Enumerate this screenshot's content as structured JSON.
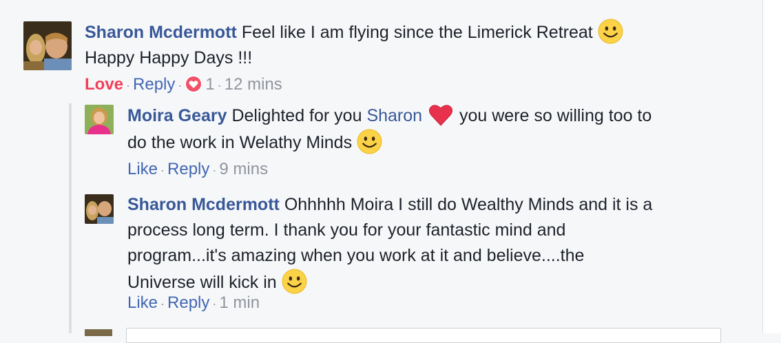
{
  "comments": [
    {
      "author": "Sharon Mcdermott",
      "text_line1": "Feel like I am flying since the Limerick Retreat",
      "text_line2": "Happy Happy Days !!!",
      "love_label": "Love",
      "reply_label": "Reply",
      "reaction_count": "1",
      "time": "12 mins"
    },
    {
      "author": "Moira Geary",
      "text_a": "Delighted for you",
      "mention": "Sharon",
      "text_b": "you were so willing too to",
      "text_line2": "do the work in Welathy Minds",
      "like_label": "Like",
      "reply_label": "Reply",
      "time": "9 mins"
    },
    {
      "author": "Sharon Mcdermott",
      "text_line1": "Ohhhhh Moira I still do Wealthy Minds and it is a",
      "text_line2": "process long term. I thank you for your fantastic mind and",
      "text_line3": "program...it's amazing when you work at it and believe....the",
      "text_line4": "Universe will kick in",
      "like_label": "Like",
      "reply_label": "Reply",
      "time": "1 min"
    }
  ],
  "separator": "·",
  "colors": {
    "author": "#385898",
    "link": "#4267b2",
    "love": "#f33e58",
    "meta": "#90949c",
    "background": "#f6f7f9"
  },
  "icons": [
    "smile-emoji-icon",
    "red-heart-emoji-icon",
    "love-reaction-icon"
  ]
}
